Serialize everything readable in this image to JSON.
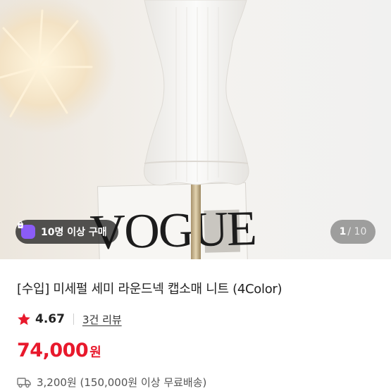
{
  "product_image": {
    "background_text": "VOGUE",
    "buyers_badge": {
      "icon": "shopping-bag-icon",
      "label": "10명 이상 구매"
    },
    "pagination": {
      "current": "1",
      "separator": "/ 10"
    }
  },
  "product": {
    "title": "[수입] 미세펄 세미 라운드넥 캡소매 니트 (4Color)",
    "rating": "4.67",
    "review_link": "3건 리뷰",
    "price": "74,000",
    "currency": "원",
    "shipping": {
      "icon": "truck-icon",
      "text": "3,200원 (150,000원 이상 무료배송)"
    }
  },
  "colors": {
    "price_red": "#e8192c",
    "star_red": "#e8192c",
    "badge_purple": "#8b5cf6"
  }
}
